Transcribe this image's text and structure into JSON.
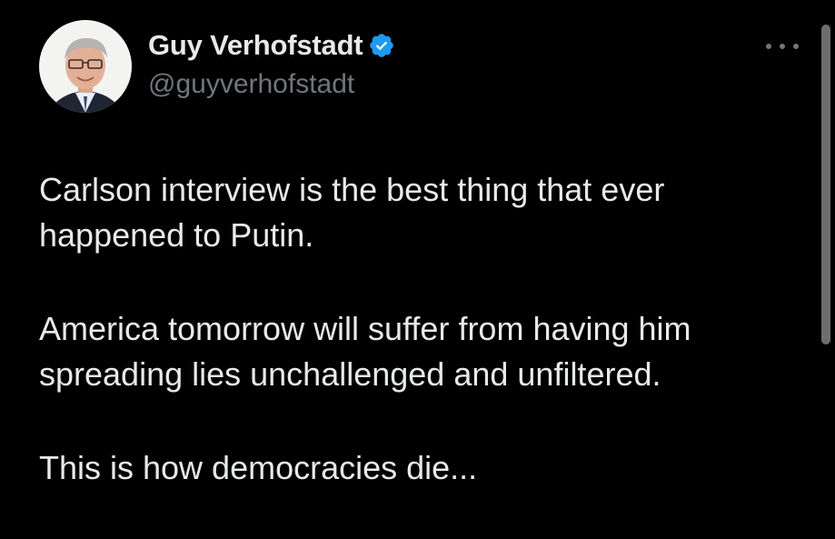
{
  "author": {
    "display_name": "Guy Verhofstadt",
    "handle": "@guyverhofstadt",
    "verified_icon": "verified-badge-icon"
  },
  "menu": {
    "icon": "more-options-icon"
  },
  "tweet": {
    "paragraphs": [
      [
        "Carlson interview is the best thing that ever",
        "happened to Putin."
      ],
      [
        "America tomorrow will suffer from having him",
        "spreading lies unchallenged and unfiltered."
      ],
      [
        "This is how democracies die..."
      ]
    ]
  },
  "colors": {
    "background": "#000000",
    "text_primary": "#e7e9ea",
    "text_secondary": "#71767b",
    "verified_blue": "#1d9bf0"
  }
}
